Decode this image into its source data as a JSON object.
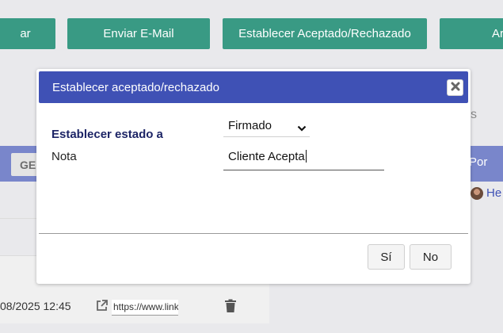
{
  "toolbar": {
    "partial_left_label": "ar",
    "send_email_label": "Enviar E-Mail",
    "set_accepted_label": "Establecer Aceptado/Rechazado",
    "partial_right_label": "Ar"
  },
  "background": {
    "partial_header_label": "GE",
    "partial_column_label": "Por",
    "partial_text_s": "s",
    "row_date": "08/2025 12:45",
    "row_url": "https://www.link",
    "partial_user": "He"
  },
  "modal": {
    "title": "Establecer aceptado/rechazado",
    "status_label": "Establecer estado a",
    "status_value": "Firmado",
    "note_label": "Nota",
    "note_value": "Cliente Acepta",
    "yes_label": "Sí",
    "no_label": "No"
  },
  "colors": {
    "toolbar_button": "#399a84",
    "modal_header": "#3f51b5",
    "table_header": "#7986cb"
  }
}
